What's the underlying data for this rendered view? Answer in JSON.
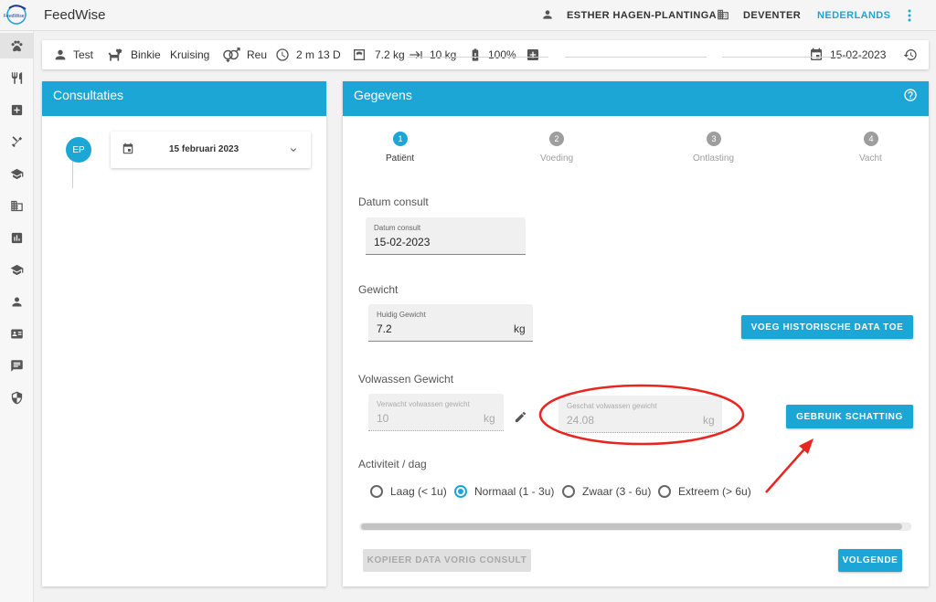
{
  "app": {
    "title": "FeedWise",
    "logo_text": "FeedWise"
  },
  "topbar": {
    "user": "ESTHER HAGEN-PLANTINGA",
    "city": "DEVENTER",
    "language": "NEDERLANDS"
  },
  "patient": {
    "owner": "Test",
    "pet": "Binkie",
    "breed": "Kruising",
    "sex": "Reu",
    "age": "2 m 13 D",
    "current_weight": "7.2 kg",
    "target_weight": "10 kg",
    "condition": "100%",
    "date": "15-02-2023"
  },
  "consultations": {
    "title": "Consultaties",
    "avatar": "EP",
    "entries": [
      {
        "date": "15 februari 2023"
      }
    ]
  },
  "details": {
    "title": "Gegevens",
    "steps": [
      {
        "num": "1",
        "label": "Patiënt",
        "active": true
      },
      {
        "num": "2",
        "label": "Voeding",
        "active": false
      },
      {
        "num": "3",
        "label": "Ontlasting",
        "active": false
      },
      {
        "num": "4",
        "label": "Vacht",
        "active": false
      }
    ],
    "consult_date": {
      "section": "Datum consult",
      "label": "Datum consult",
      "value": "15-02-2023"
    },
    "weight": {
      "section": "Gewicht",
      "label": "Huidig Gewicht",
      "value": "7.2",
      "unit": "kg",
      "history_button": "VOEG HISTORISCHE DATA TOE"
    },
    "adult_weight": {
      "section": "Volwassen Gewicht",
      "expected_label": "Verwacht volwassen gewicht",
      "expected_value": "10",
      "expected_unit": "kg",
      "estimated_label": "Geschat volwassen gewicht",
      "estimated_value": "24.08",
      "estimated_unit": "kg",
      "use_estimate_button": "GEBRUIK SCHATTING"
    },
    "activity": {
      "section": "Activiteit / dag",
      "options": [
        {
          "label": "Laag (< 1u)",
          "selected": false
        },
        {
          "label": "Normaal (1 - 3u)",
          "selected": true
        },
        {
          "label": "Zwaar (3 - 6u)",
          "selected": false
        },
        {
          "label": "Extreem (> 6u)",
          "selected": false
        }
      ]
    },
    "copy_button": "KOPIEER DATA VORIG CONSULT",
    "next_button": "VOLGENDE"
  },
  "colors": {
    "accent": "#1ca6d6",
    "annotation": "#e8251f"
  },
  "icons": {
    "sidebar": [
      "paw-icon",
      "fork-knife-icon",
      "medical-plus-icon",
      "tools-icon",
      "school-icon",
      "building-icon",
      "chart-icon",
      "school-icon",
      "person-icon",
      "id-card-icon",
      "chat-icon",
      "shield-icon"
    ]
  }
}
